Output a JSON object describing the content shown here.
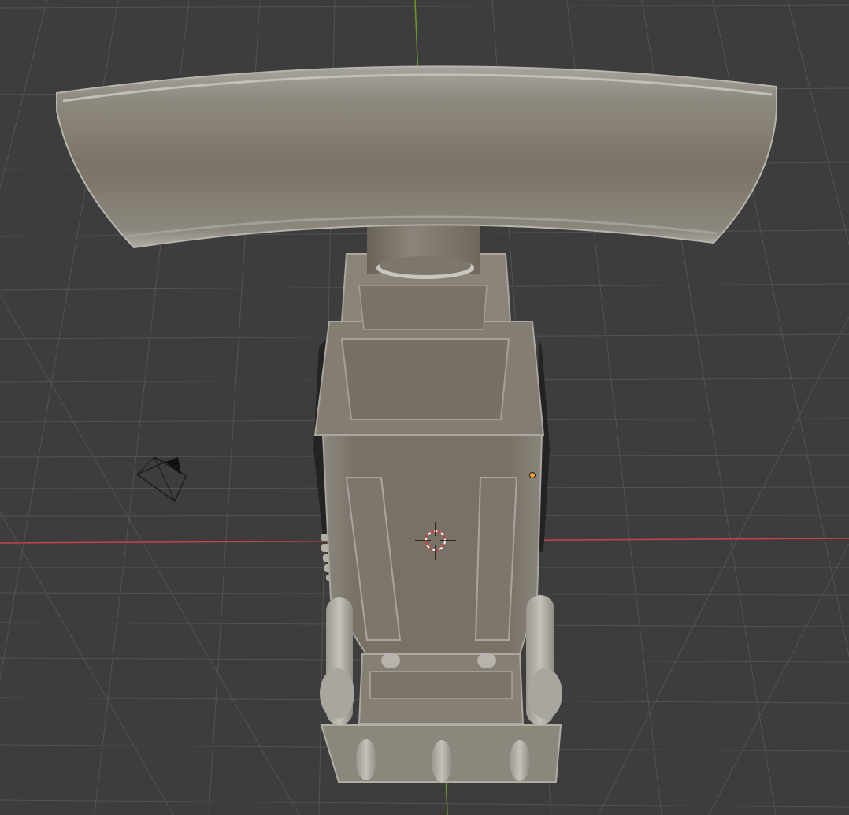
{
  "viewport": {
    "background_color": "#3d3d3d",
    "grid_color": "#565656",
    "x_axis_color": "#c8424b",
    "y_axis_color": "#6f9a2b",
    "model_color": "#7b7466",
    "model_light": "#9a958b",
    "model_highlight": "#b4b1aa",
    "origin_color": "#f0a23a"
  },
  "scene": {
    "objects": [
      {
        "name": "model",
        "icon": "mesh-object"
      },
      {
        "name": "camera",
        "icon": "camera-icon"
      },
      {
        "name": "3d-cursor",
        "icon": "cursor-crosshair-icon"
      },
      {
        "name": "object-origin",
        "icon": "origin-dot-icon"
      }
    ]
  }
}
